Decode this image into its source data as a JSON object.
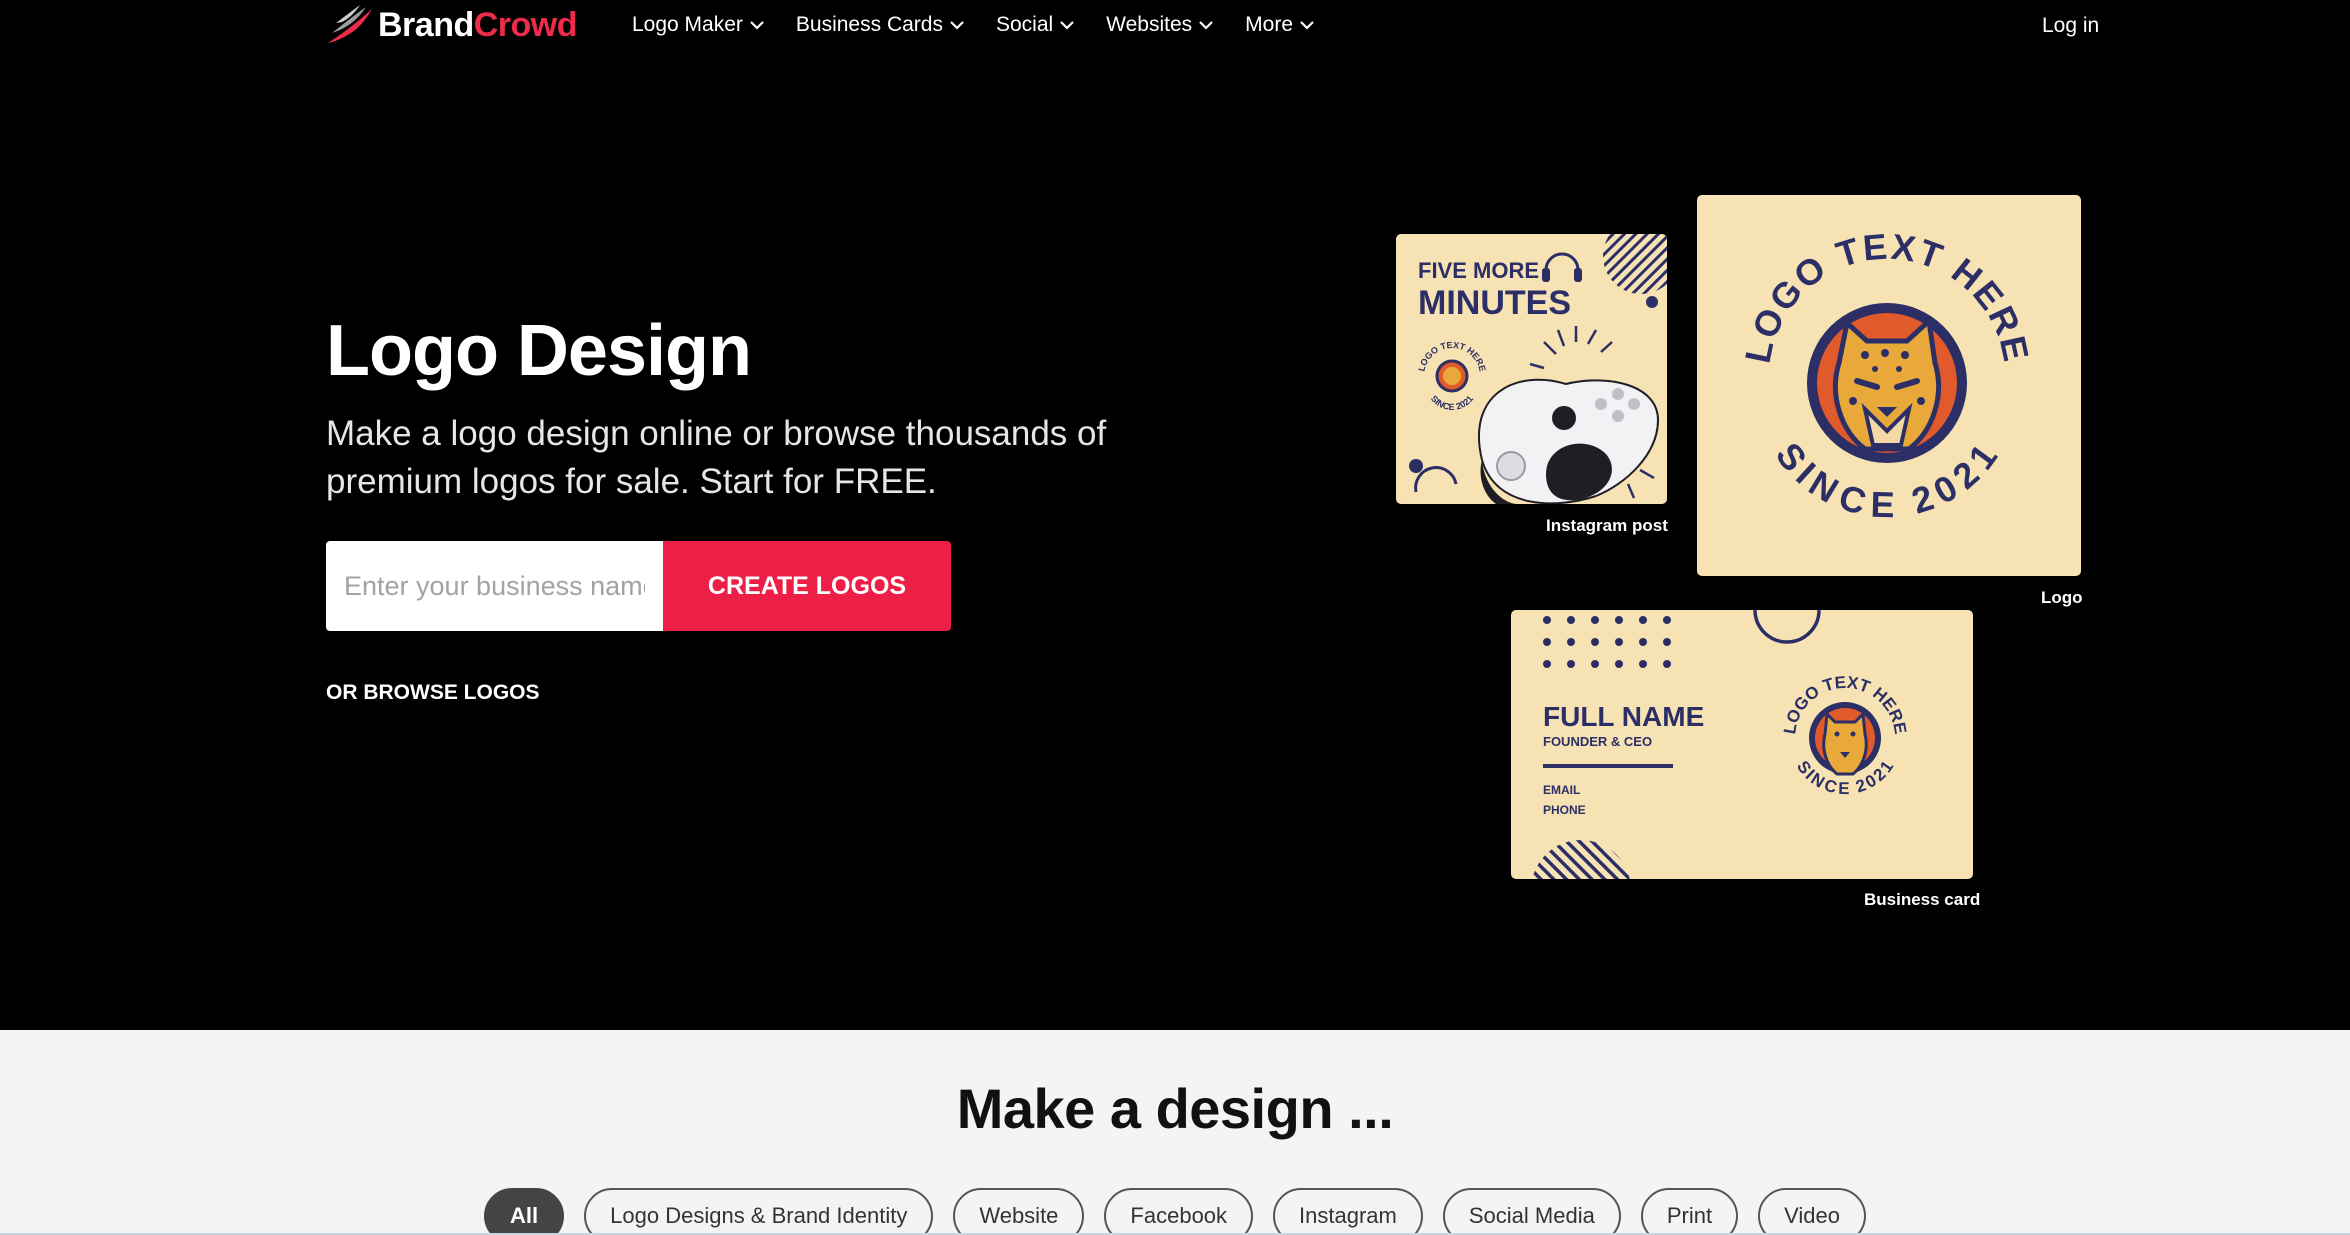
{
  "brand": {
    "part1": "Brand",
    "part2": "Crowd",
    "accent": "#ee2c4a"
  },
  "nav": {
    "items": [
      {
        "label": "Logo Maker"
      },
      {
        "label": "Business Cards"
      },
      {
        "label": "Social"
      },
      {
        "label": "Websites"
      },
      {
        "label": "More"
      }
    ],
    "login": "Log in"
  },
  "hero": {
    "title": "Logo Design",
    "subtitle": "Make a logo design online or browse thousands of premium logos for sale. Start for FREE.",
    "search_placeholder": "Enter your business name",
    "create_label": "CREATE LOGOS",
    "browse_label": "OR BROWSE LOGOS",
    "cta_color": "#ee1f46"
  },
  "mockups": {
    "instagram": {
      "caption": "Instagram post",
      "line1": "FIVE MORE",
      "line2": "MINUTES",
      "badge_top": "LOGO TEXT HERE",
      "badge_bottom": "SINCE 2021"
    },
    "logo": {
      "caption": "Logo",
      "ring_top": "LOGO TEXT HERE",
      "ring_bottom": "SINCE 2021"
    },
    "business_card": {
      "caption": "Business card",
      "name": "FULL NAME",
      "role": "FOUNDER & CEO",
      "email": "EMAIL",
      "phone": "PHONE",
      "badge_top": "LOGO TEXT HERE",
      "badge_bottom": "SINCE 2021"
    },
    "colors": {
      "cream": "#f7e2b4",
      "navy": "#2b2f66",
      "orange": "#e05a2b",
      "gold": "#e9a93a"
    }
  },
  "design_section": {
    "title": "Make a design ...",
    "pills": [
      "All",
      "Logo Designs & Brand Identity",
      "Website",
      "Facebook",
      "Instagram",
      "Social Media",
      "Print",
      "Video"
    ],
    "active_index": 0
  }
}
